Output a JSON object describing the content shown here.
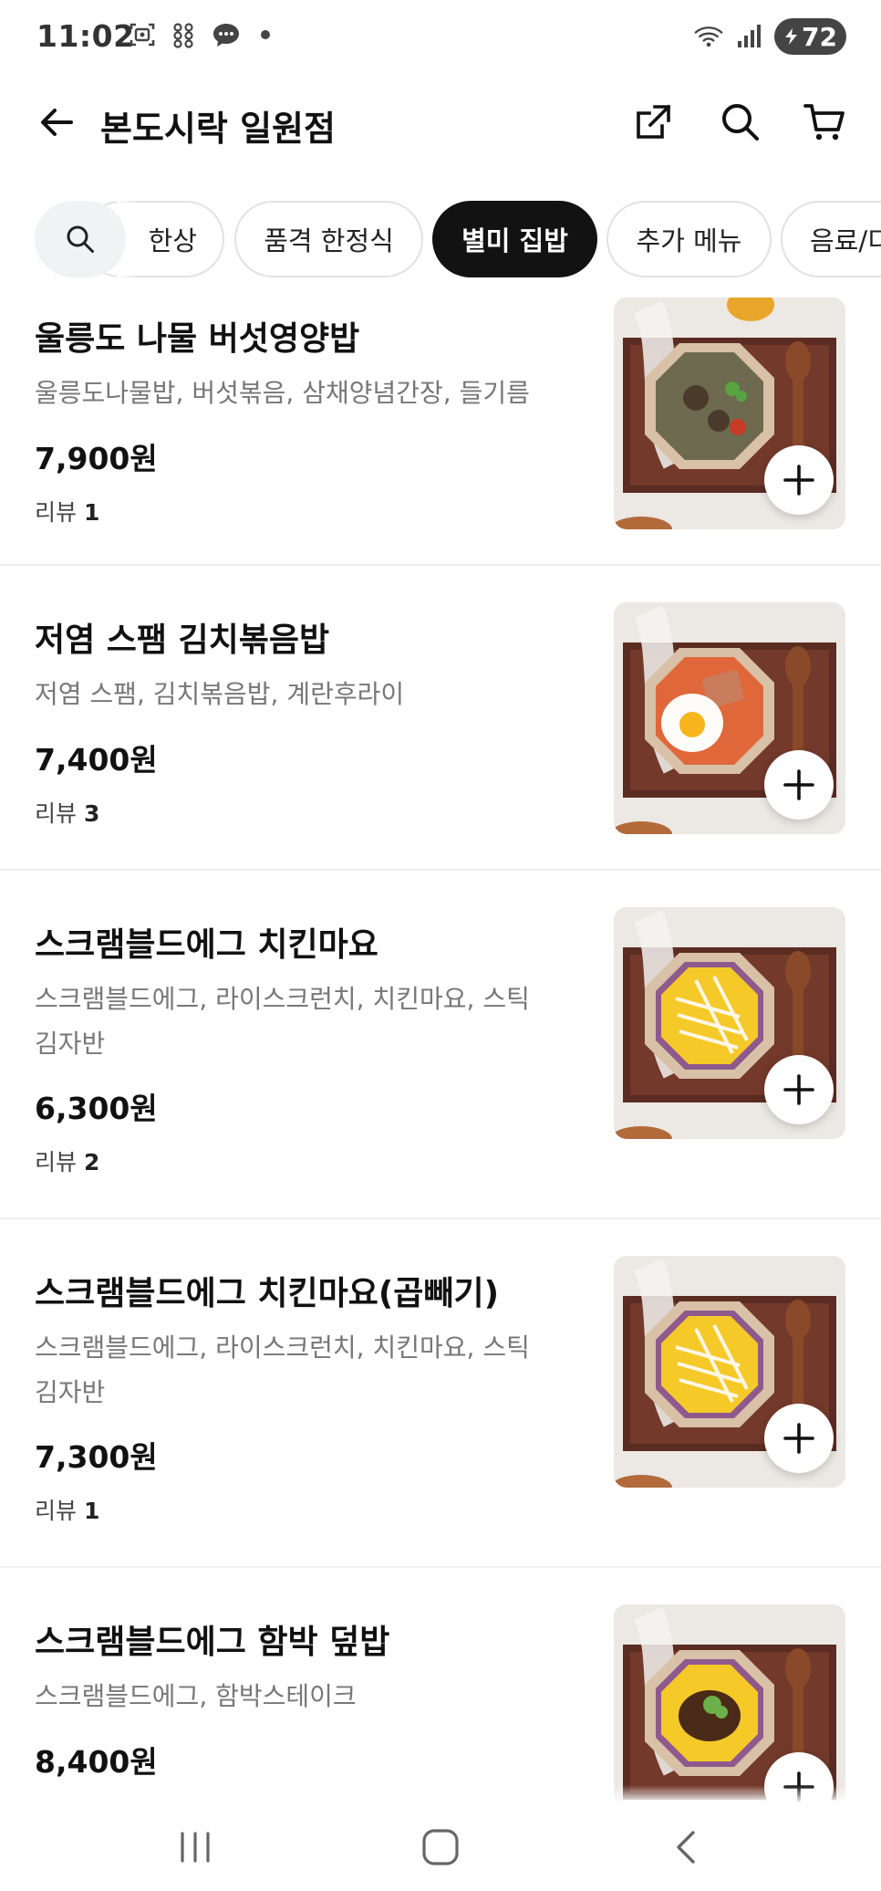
{
  "status_bar": {
    "time": "11:02",
    "battery": "72"
  },
  "header": {
    "title": "본도시락 일원점"
  },
  "categories": [
    {
      "label": "한상"
    },
    {
      "label": "품격 한정식"
    },
    {
      "label": "별미 집밥",
      "active": true
    },
    {
      "label": "추가 메뉴"
    },
    {
      "label": "음료/디"
    }
  ],
  "menu_items": [
    {
      "name": "울릉도 나물 버섯영양밥",
      "description": "울릉도나물밥, 버섯볶음, 삼채양념간장, 들기름",
      "price": "7,900원",
      "review_label": "리뷰",
      "review_count": "1"
    },
    {
      "name": "저염 스팸 김치볶음밥",
      "description": "저염 스팸, 김치볶음밥, 계란후라이",
      "price": "7,400원",
      "review_label": "리뷰",
      "review_count": "3"
    },
    {
      "name": "스크램블드에그 치킨마요",
      "description": "스크램블드에그, 라이스크런치, 치킨마요, 스틱김자반",
      "price": "6,300원",
      "review_label": "리뷰",
      "review_count": "2"
    },
    {
      "name": "스크램블드에그 치킨마요(곱빼기)",
      "description": "스크램블드에그, 라이스크런치, 치킨마요, 스틱김자반",
      "price": "7,300원",
      "review_label": "리뷰",
      "review_count": "1"
    },
    {
      "name": "스크램블드에그 함박 덮밥",
      "description": "스크램블드에그, 함박스테이크",
      "price": "8,400원"
    }
  ],
  "icons": {
    "back": "arrow-left-icon",
    "share": "share-icon",
    "search": "search-icon",
    "cart": "cart-icon",
    "add": "plus-icon"
  },
  "colors": {
    "active_chip": "#121212",
    "price_text": "#111111",
    "desc_text": "#777777"
  }
}
